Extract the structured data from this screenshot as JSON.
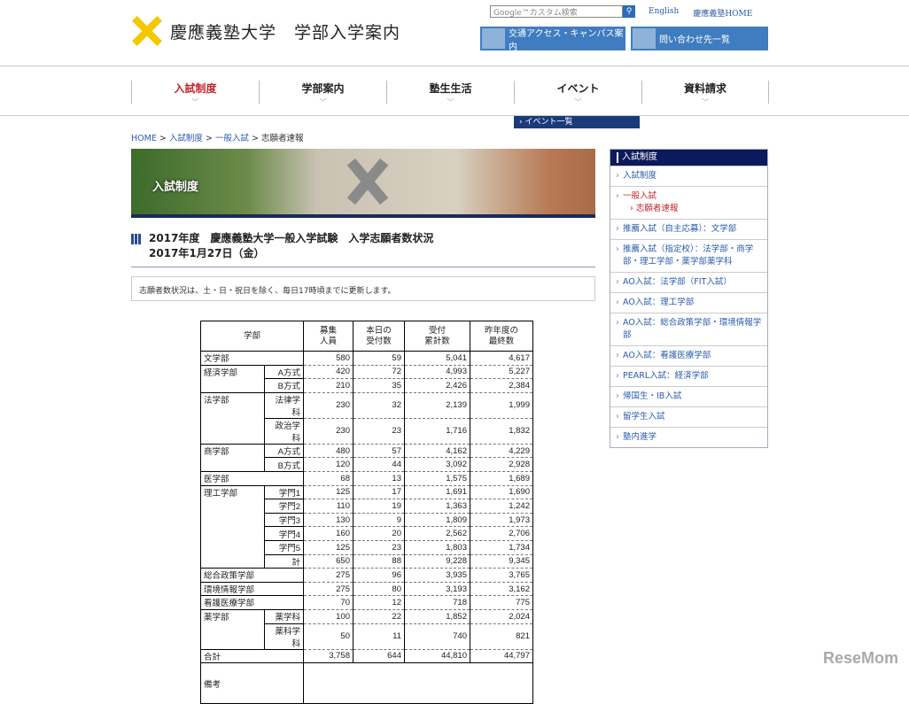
{
  "header": {
    "logo_text": "慶應義塾大学　学部入学案内",
    "search_placeholder": "Google™カスタム検索",
    "search_icon": "search-icon",
    "english": "English",
    "keio_home": "慶應義塾HOME",
    "access_btn": "交通アクセス・キャンパス案内",
    "contact_btn": "問い合わせ先一覧"
  },
  "nav": {
    "items": [
      "入試制度",
      "学部案内",
      "塾生生活",
      "イベント",
      "資料請求"
    ],
    "active_color": "#c0282e",
    "dropdown": "イベント一覧"
  },
  "breadcrumb": {
    "home": "HOME",
    "l1": "入試制度",
    "l2": "一般入試",
    "current": "志願者速報",
    "sep": ">"
  },
  "banner": {
    "title": "入試制度"
  },
  "heading": {
    "line1": "2017年度　慶應義塾大学一般入学試験　入学志願者数状況",
    "line2": "2017年1月27日（金）"
  },
  "notice": "志願者数状況は、土・日・祝日を除く、毎日17時頃までに更新します。",
  "table": {
    "headers": [
      "学部",
      "募集\n人員",
      "本日の\n受付数",
      "受付\n累計数",
      "昨年度の\n最終数"
    ],
    "groups": [
      {
        "name": "文学部",
        "rows": [
          {
            "sub": "",
            "v": [
              "580",
              "59",
              "5,041",
              "4,617"
            ]
          }
        ]
      },
      {
        "name": "経済学部",
        "rows": [
          {
            "sub": "A方式",
            "v": [
              "420",
              "72",
              "4,993",
              "5,227"
            ]
          },
          {
            "sub": "B方式",
            "v": [
              "210",
              "35",
              "2,426",
              "2,384"
            ]
          }
        ]
      },
      {
        "name": "法学部",
        "rows": [
          {
            "sub": "法律学科",
            "v": [
              "230",
              "32",
              "2,139",
              "1,999"
            ]
          },
          {
            "sub": "政治学科",
            "v": [
              "230",
              "23",
              "1,716",
              "1,832"
            ]
          }
        ]
      },
      {
        "name": "商学部",
        "rows": [
          {
            "sub": "A方式",
            "v": [
              "480",
              "57",
              "4,162",
              "4,229"
            ]
          },
          {
            "sub": "B方式",
            "v": [
              "120",
              "44",
              "3,092",
              "2,928"
            ]
          }
        ]
      },
      {
        "name": "医学部",
        "rows": [
          {
            "sub": "",
            "v": [
              "68",
              "13",
              "1,575",
              "1,689"
            ]
          }
        ]
      },
      {
        "name": "理工学部",
        "rows": [
          {
            "sub": "学門1",
            "v": [
              "125",
              "17",
              "1,691",
              "1,690"
            ]
          },
          {
            "sub": "学門2",
            "v": [
              "110",
              "19",
              "1,363",
              "1,242"
            ]
          },
          {
            "sub": "学門3",
            "v": [
              "130",
              "9",
              "1,809",
              "1,973"
            ]
          },
          {
            "sub": "学門4",
            "v": [
              "160",
              "20",
              "2,562",
              "2,706"
            ]
          },
          {
            "sub": "学門5",
            "v": [
              "125",
              "23",
              "1,803",
              "1,734"
            ]
          },
          {
            "sub": "計",
            "v": [
              "650",
              "88",
              "9,228",
              "9,345"
            ]
          }
        ]
      },
      {
        "name": "総合政策学部",
        "rows": [
          {
            "sub": "",
            "v": [
              "275",
              "96",
              "3,935",
              "3,765"
            ]
          }
        ]
      },
      {
        "name": "環境情報学部",
        "rows": [
          {
            "sub": "",
            "v": [
              "275",
              "80",
              "3,193",
              "3,162"
            ]
          }
        ]
      },
      {
        "name": "看護医療学部",
        "rows": [
          {
            "sub": "",
            "v": [
              "70",
              "12",
              "718",
              "775"
            ]
          }
        ]
      },
      {
        "name": "薬学部",
        "rows": [
          {
            "sub": "薬学科",
            "v": [
              "100",
              "22",
              "1,852",
              "2,024"
            ]
          },
          {
            "sub": "薬科学科",
            "v": [
              "50",
              "11",
              "740",
              "821"
            ]
          }
        ]
      },
      {
        "name": "合計",
        "rows": [
          {
            "sub": "",
            "v": [
              "3,758",
              "644",
              "44,810",
              "44,797"
            ]
          }
        ]
      }
    ],
    "remarks_label": "備考"
  },
  "sidebar": {
    "title": "入試制度",
    "items": [
      "入試制度",
      "一般入試",
      "推薦入試（自主応募）：文学部",
      "推薦入試（指定校）：法学部・商学部・理工学部・薬学部薬学科",
      "AO入試：法学部（FIT入試）",
      "AO入試：理工学部",
      "AO入試：総合政策学部・環境情報学部",
      "AO入試：看護医療学部",
      "PEARL入試：経済学部",
      "帰国生・IB入試",
      "留学生入試",
      "塾内進学"
    ],
    "child": "志願者速報"
  },
  "watermark": "ReseMom"
}
